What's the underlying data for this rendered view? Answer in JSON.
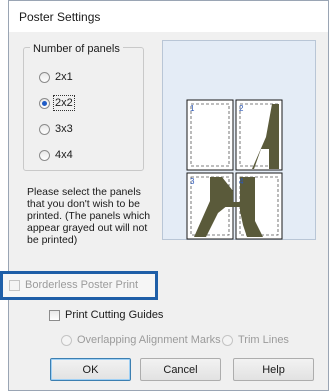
{
  "window": {
    "title": "Poster Settings"
  },
  "panels": {
    "legend": "Number of panels",
    "options": [
      {
        "label": "2x1",
        "selected": false
      },
      {
        "label": "2x2",
        "selected": true
      },
      {
        "label": "3x3",
        "selected": false
      },
      {
        "label": "4x4",
        "selected": false
      }
    ]
  },
  "info_text": "Please select the panels that you don't wish to be printed. (The panels which appear grayed out will not be printed)",
  "preview": {
    "panel_numbers": [
      "1",
      "2",
      "3",
      "4"
    ],
    "letter": "A"
  },
  "options": {
    "borderless": {
      "label": "Borderless Poster Print",
      "checked": false,
      "enabled": false
    },
    "cutting_guides": {
      "label": "Print Cutting Guides",
      "checked": false,
      "enabled": true
    },
    "overlapping_marks": {
      "label": "Overlapping Alignment Marks",
      "enabled": false
    },
    "trim_lines": {
      "label": "Trim Lines",
      "enabled": false
    }
  },
  "buttons": {
    "ok": "OK",
    "cancel": "Cancel",
    "help": "Help"
  },
  "colors": {
    "accent": "#1f5fa8",
    "panel_number": "#2b57b7",
    "letter": "#5a5a3a"
  }
}
